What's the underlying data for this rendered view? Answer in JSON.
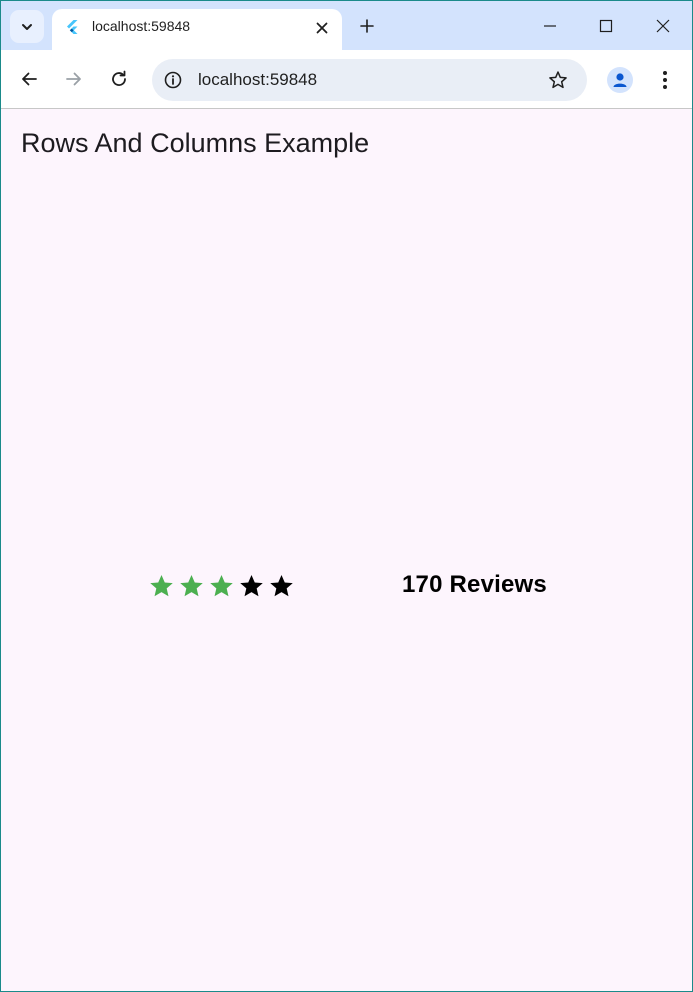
{
  "browser": {
    "tab": {
      "title": "localhost:59848",
      "favicon": "flutter-icon"
    },
    "omnibox": {
      "url": "localhost:59848"
    },
    "icons": {
      "tab_search": "chevron-down-icon",
      "tab_close": "close-icon",
      "new_tab": "plus-icon",
      "minimize": "minimize-icon",
      "maximize": "maximize-icon",
      "close_window": "close-icon",
      "back": "arrow-left-icon",
      "forward": "arrow-right-icon",
      "reload": "reload-icon",
      "site_info": "info-icon",
      "bookmark": "star-outline-icon",
      "profile": "person-icon",
      "menu": "kebab-menu-icon"
    },
    "colors": {
      "tabstrip": "#d3e3fd",
      "omnibox": "#e9eef6"
    }
  },
  "app": {
    "title": "Rows And Columns Example",
    "rating": {
      "filled": 3,
      "total": 5,
      "filled_color": "#4caf50",
      "empty_color": "#000000"
    },
    "reviews_label": "170 Reviews",
    "background": "#fdf5fd"
  }
}
